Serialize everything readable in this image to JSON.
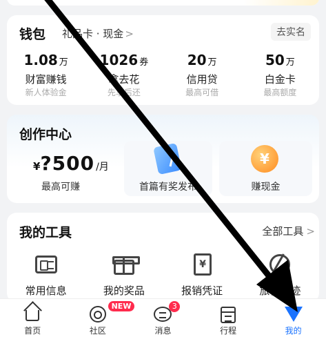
{
  "wallet": {
    "title": "钱包",
    "subtitle": "礼品卡 · 现金",
    "subtitle_chevron": ">",
    "realname_button": "去实名",
    "items": [
      {
        "value": "1.08",
        "unit": "万",
        "label": "财富赚钱",
        "desc": "新人体验金"
      },
      {
        "value": "1026",
        "unit": "券",
        "label": "拿去花",
        "desc": "先享后还"
      },
      {
        "value": "20",
        "unit": "万",
        "label": "信用贷",
        "desc": "最高可借"
      },
      {
        "value": "50",
        "unit": "万",
        "label": "白金卡",
        "desc": "最高额度"
      }
    ]
  },
  "creator": {
    "title": "创作中心",
    "currency": "¥",
    "amount": "?500",
    "period": "/月",
    "amount_label": "最高可赚",
    "coin_symbol": "¥",
    "cards": [
      {
        "label": "首篇有奖发布",
        "icon": "document-icon"
      },
      {
        "label": "赚现金",
        "icon": "coin-icon"
      }
    ]
  },
  "tools": {
    "title": "我的工具",
    "all_label": "全部工具",
    "all_chevron": ">",
    "items": [
      {
        "label": "常用信息",
        "icon": "id-card-icon"
      },
      {
        "label": "我的奖品",
        "icon": "gift-icon"
      },
      {
        "label": "报销凭证",
        "icon": "receipt-icon",
        "glyph": "¥"
      },
      {
        "label": "旅行足迹",
        "icon": "globe-icon"
      }
    ]
  },
  "nav": {
    "items": [
      {
        "label": "首页",
        "icon": "home-icon"
      },
      {
        "label": "社区",
        "icon": "community-icon",
        "badge": "NEW"
      },
      {
        "label": "消息",
        "icon": "message-icon",
        "badge": "3"
      },
      {
        "label": "行程",
        "icon": "calendar-icon"
      },
      {
        "label": "我的",
        "icon": "profile-icon",
        "active": true
      }
    ],
    "active_color": "#1a73ff",
    "badge_color": "#ff2b4d"
  }
}
